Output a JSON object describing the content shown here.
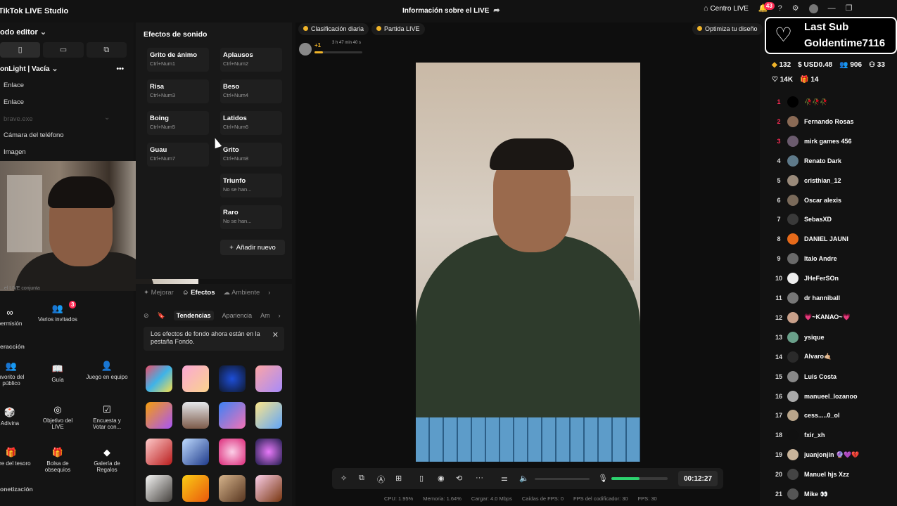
{
  "app": {
    "title": "TikTok LIVE Studio",
    "center_title": "Información sobre el LIVE",
    "centro": "Centro LIVE",
    "notif_count": "43"
  },
  "left": {
    "editor_title": "odo editor",
    "scene_name": "onLight | Vacía",
    "sources": [
      "Enlace",
      "Enlace",
      "brave.exe",
      "Cámara del teléfono",
      "Imagen"
    ],
    "cut_label": "...el LIVE conjunta",
    "section_interaccion": "eracción",
    "section_monetizacion": "onetización",
    "tools": [
      {
        "icon": "∞",
        "label": "permisión"
      },
      {
        "icon": "👥",
        "label": "Varios invitados",
        "badge": "3"
      },
      {
        "icon": "👥",
        "label": "avorito del público"
      },
      {
        "icon": "📖",
        "label": "Guía"
      },
      {
        "icon": "👤",
        "label": "Juego en equipo"
      },
      {
        "icon": "🎲",
        "label": "Adivina"
      },
      {
        "icon": "◎",
        "label": "Objetivo del LIVE"
      },
      {
        "icon": "☑",
        "label": "Encuesta y Votar con..."
      },
      {
        "icon": "🎁",
        "label": "cofre del tesoro"
      },
      {
        "icon": "🎁",
        "label": "Bolsa de obsequios"
      },
      {
        "icon": "◆",
        "label": "Galería de Regalos"
      }
    ]
  },
  "sound": {
    "title": "Efectos de sonido",
    "effects": [
      {
        "name": "Grito de ánimo",
        "key": "Ctrl+Num1"
      },
      {
        "name": "Aplausos",
        "key": "Ctrl+Num2"
      },
      {
        "name": "Risa",
        "key": "Ctrl+Num3"
      },
      {
        "name": "Beso",
        "key": "Ctrl+Num4"
      },
      {
        "name": "Boing",
        "key": "Ctrl+Num5"
      },
      {
        "name": "Latidos",
        "key": "Ctrl+Num6"
      },
      {
        "name": "Guau",
        "key": "Ctrl+Num7"
      },
      {
        "name": "Grito",
        "key": "Ctrl+Num8"
      },
      {
        "name": "Triunfo",
        "key": "No se han..."
      },
      {
        "name": "Raro",
        "key": "No se han..."
      }
    ],
    "add_new": "Añadir nuevo"
  },
  "effects": {
    "tabs": [
      "Mejorar",
      "Efectos",
      "Ambiente"
    ],
    "subtabs": [
      "Tendencias",
      "Apariencia",
      "Am"
    ],
    "notice": "Los efectos de fondo ahora están en la pestaña Fondo."
  },
  "preview": {
    "pill_ranking": "Clasificación diaria",
    "pill_match": "Partida LIVE",
    "pill_design": "Optimiza tu diseño",
    "host_timer": "3 h 47 min 40 s",
    "host_plus": "+1",
    "timer": "00:12:27",
    "volume_level": 0.5
  },
  "stats": {
    "cpu": "CPU: 1.95%",
    "mem": "Memoria: 1.64%",
    "upload": "Cargar: 4.0 Mbps",
    "fps_drop": "Caídas de FPS: 0",
    "encoder": "FPS del codificador: 30",
    "fps": "FPS: 30"
  },
  "right": {
    "last_sub_title": "Last Sub",
    "last_sub_name": "Goldentime7116",
    "coins": "132",
    "usd": "USD0.48",
    "viewers": "906",
    "extra": "33",
    "likes": "14K",
    "gifts": "14",
    "ranking": [
      {
        "rank": "1",
        "name": "🥀🥀🥀"
      },
      {
        "rank": "2",
        "name": "Fernando Rosas"
      },
      {
        "rank": "3",
        "name": "mirk games 456"
      },
      {
        "rank": "4",
        "name": "Renato Dark"
      },
      {
        "rank": "5",
        "name": "cristhian_12"
      },
      {
        "rank": "6",
        "name": "Oscar alexis"
      },
      {
        "rank": "7",
        "name": "SebasXD"
      },
      {
        "rank": "8",
        "name": "DANIEL JAUNI"
      },
      {
        "rank": "9",
        "name": "Italo Andre"
      },
      {
        "rank": "10",
        "name": "JHeFerSOn"
      },
      {
        "rank": "11",
        "name": "dr hanniball"
      },
      {
        "rank": "12",
        "name": "💗~ΚΑΝΑΟ~💗"
      },
      {
        "rank": "13",
        "name": "ysique"
      },
      {
        "rank": "14",
        "name": "Alvaro🤙🏼"
      },
      {
        "rank": "15",
        "name": "Luis Costa"
      },
      {
        "rank": "16",
        "name": "manueel_lozanoo"
      },
      {
        "rank": "17",
        "name": "cess.....0_ol"
      },
      {
        "rank": "18",
        "name": "fxir_xh"
      },
      {
        "rank": "19",
        "name": "juanjonjin 🔮💜💔"
      },
      {
        "rank": "20",
        "name": "Manuel hjs Xzz"
      },
      {
        "rank": "21",
        "name": "Mike 👀"
      }
    ]
  }
}
